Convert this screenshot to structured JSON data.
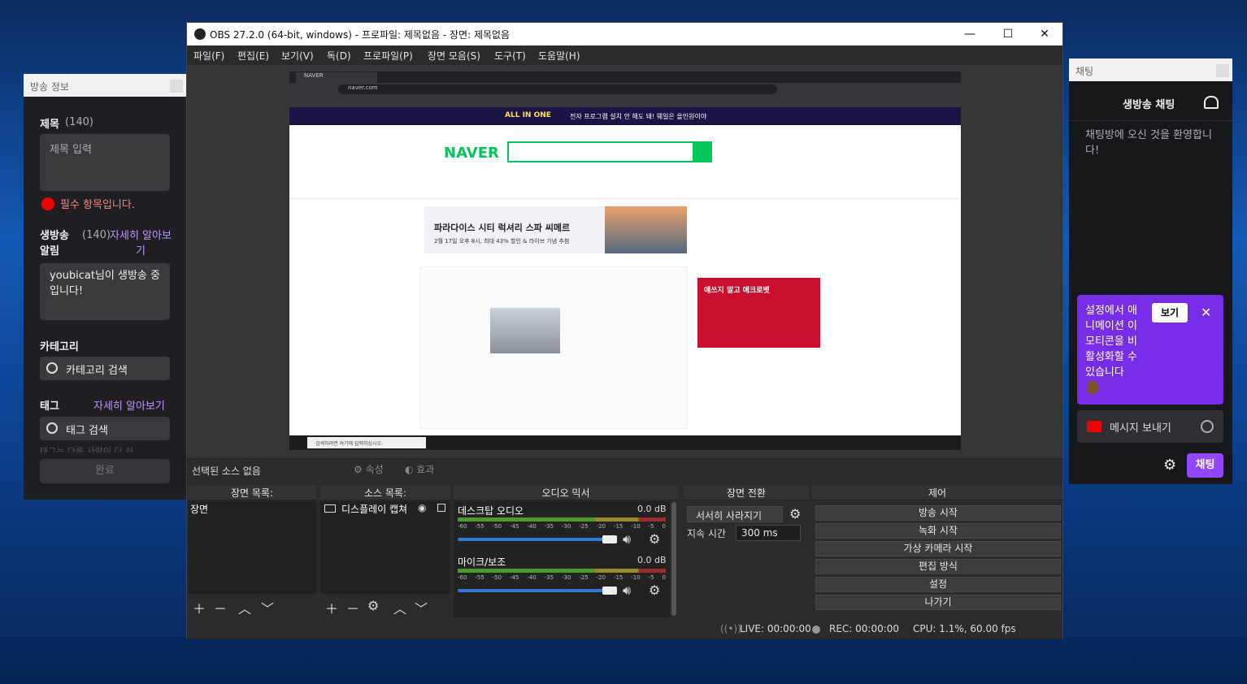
{
  "obs": {
    "title": "OBS 27.2.0 (64-bit, windows) - 프로파일: 제목없음 - 장면: 제목없음",
    "menu": [
      "파일(F)",
      "편집(E)",
      "보기(V)",
      "독(D)",
      "프로파일(P)",
      "장면 모음(S)",
      "도구(T)",
      "도움말(H)"
    ],
    "source_none": "선택된 소스 없음",
    "props": "속성",
    "filters": "효과",
    "scenes_title": "장면 목록:",
    "scene_item": "장면",
    "sources_title": "소스 목록:",
    "source_item": "디스플레이 캡쳐",
    "mixer_title": "오디오 믹서",
    "desktop_audio": "데스크탑 오디오",
    "desktop_db": "0.0 dB",
    "mic_audio": "마이크/보조",
    "mic_db": "0.0 dB",
    "meter_ticks": [
      "-60",
      "-55",
      "-50",
      "-45",
      "-40",
      "-35",
      "-30",
      "-25",
      "-20",
      "-15",
      "-10",
      "-5",
      "0"
    ],
    "transitions_title": "장면 전환",
    "transition": "서서히 사라지기",
    "duration_label": "지속 시간",
    "duration": "300 ms",
    "controls_title": "제어",
    "controls": [
      "방송 시작",
      "녹화 시작",
      "가상 카메라 시작",
      "편집 방식",
      "설정",
      "나가기"
    ],
    "live": "LIVE: 00:00:00",
    "rec": "REC: 00:00:00",
    "cpu": "CPU: 1.1%, 60.00 fps"
  },
  "info": {
    "header": "방송 정보",
    "title_label": "제목",
    "title_count": "(140)",
    "title_placeholder": "제목 입력",
    "required": "필수 항목입니다.",
    "notif_label": "생방송 알림",
    "notif_count": "(140)",
    "learn_more": "자세히 알아보기",
    "notif_value": "youbicat님이 생방송 중입니다!",
    "category_label": "카테고리",
    "category_placeholder": "카테고리 검색",
    "tags_label": "태그",
    "tags_learn": "자세히 알아보기",
    "tags_placeholder": "태그 검색",
    "tags_hint": "태그는 다른 사람이 더 쉬",
    "done": "완료"
  },
  "chat": {
    "header": "채팅",
    "title": "생방송 채팅",
    "welcome": "채팅방에 오신 것을 환영합니다!",
    "toast": "설정에서 애니메이션 이모티콘을 비활성화할 수 있습니다",
    "toast_btn": "보기",
    "input_placeholder": "메시지 보내기",
    "send": "채팅"
  },
  "screen": {
    "tab": "NAVER",
    "url": "naver.com",
    "banner": "ALL IN ONE",
    "banner_text": "전자 프로그램 설치 안 해도 돼! 웨일은 올인원이야",
    "naver": "NAVER",
    "ad_title": "파라다이스 시티 럭셔리 스파 씨메르",
    "ad_sub": "2월 17일 오후 8시, 최대 43% 할인 & 라이브 기념 추첨",
    "ad2": "얘쓰지 말고 애크로벳",
    "taskbar_search": "검색하려면 여기에 입력하십시오."
  }
}
